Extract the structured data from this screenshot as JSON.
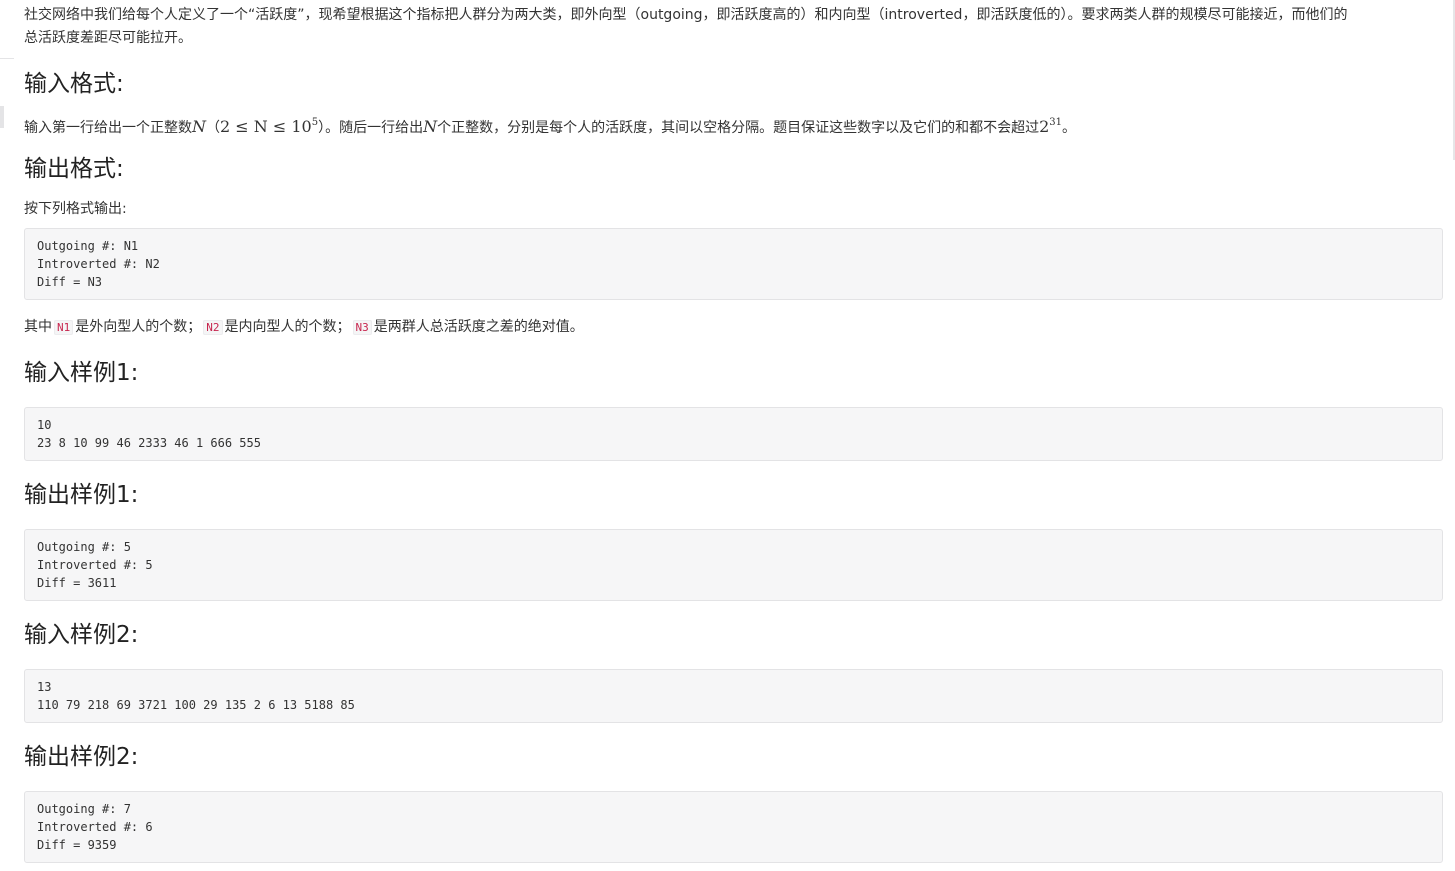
{
  "problem": {
    "intro_line1": "社交网络中我们给每个人定义了一个“活跃度”，现希望根据这个指标把人群分为两大类，即外向型（outgoing，即活跃度高的）和内向型（introverted，即活跃度低的）。要求两类人群的规模尽可能接近，而他们的",
    "intro_line2": "总活跃度差距尽可能拉开。",
    "input_format": {
      "heading": "输入格式:",
      "text_a": "输入第一行给出一个正整数",
      "math_n": "N",
      "text_b": "（",
      "math_range": "2 ≤ N ≤ 10",
      "math_exp": "5",
      "text_c": "）。随后一行给出",
      "math_n2": "N",
      "text_d": "个正整数，分别是每个人的活跃度，其间以空格分隔。题目保证这些数字以及它们的和都不会超过",
      "math_base": "2",
      "math_exp2": "31",
      "text_e": "。"
    },
    "output_format": {
      "heading": "输出格式:",
      "text": "按下列格式输出:",
      "code": "Outgoing #: N1\nIntroverted #: N2\nDiff = N3",
      "note_a": "其中",
      "n1": "N1",
      "note_b": "是外向型人的个数；",
      "n2": "N2",
      "note_c": "是内向型人的个数；",
      "n3": "N3",
      "note_d": "是两群人总活跃度之差的绝对值。"
    },
    "samples": [
      {
        "heading": "输入样例1:",
        "code": "10\n23 8 10 99 46 2333 46 1 666 555"
      },
      {
        "heading": "输出样例1:",
        "code": "Outgoing #: 5\nIntroverted #: 5\nDiff = 3611"
      },
      {
        "heading": "输入样例2:",
        "code": "13\n110 79 218 69 3721 100 29 135 2 6 13 5188 85"
      },
      {
        "heading": "输出样例2:",
        "code": "Outgoing #: 7\nIntroverted #: 6\nDiff = 9359"
      }
    ]
  }
}
